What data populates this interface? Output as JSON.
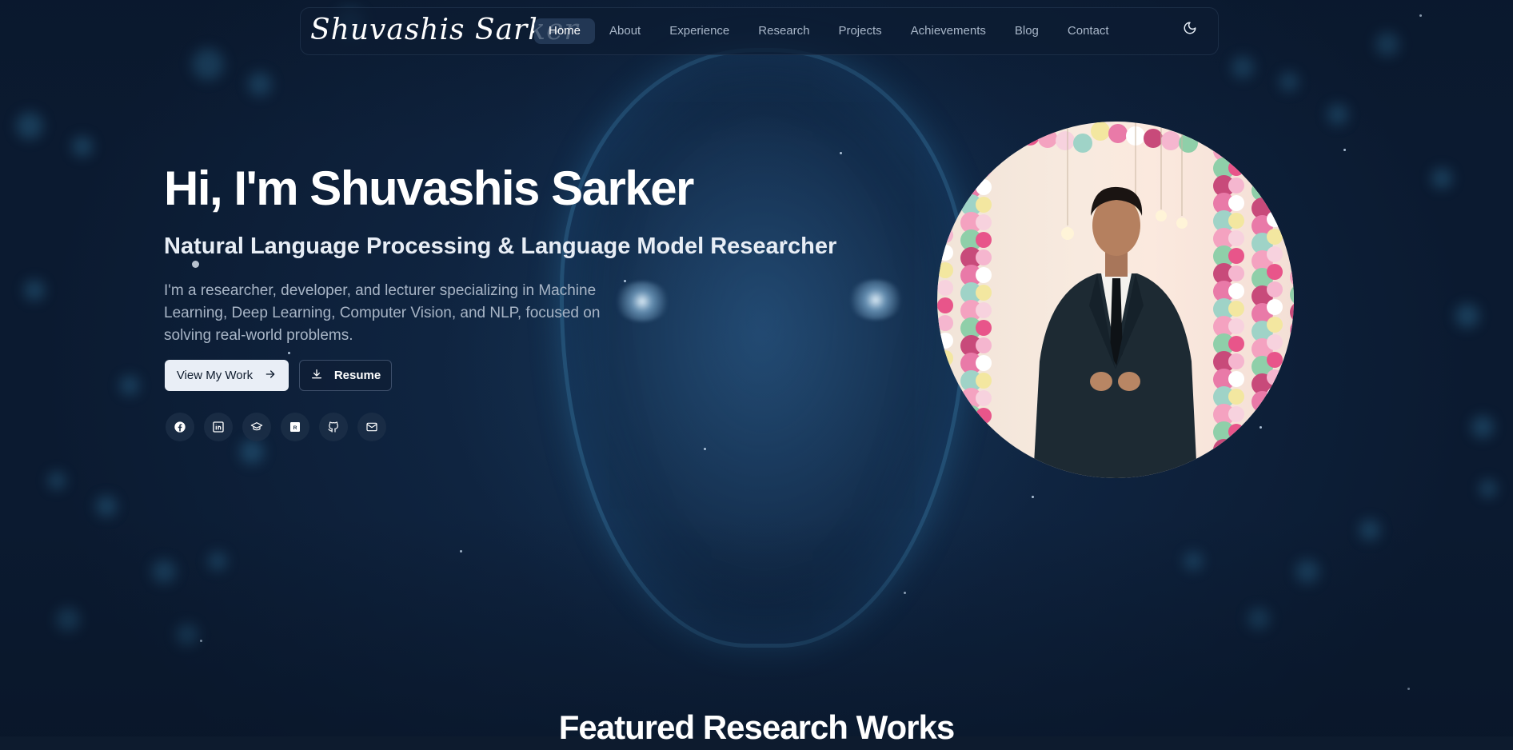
{
  "nav": {
    "logo": "Shuvashis Sarker",
    "links": [
      "Home",
      "About",
      "Experience",
      "Research",
      "Projects",
      "Achievements",
      "Blog",
      "Contact"
    ],
    "active": "Home",
    "theme_toggle_icon": "moon-icon"
  },
  "hero": {
    "title": "Hi, I'm Shuvashis Sarker",
    "subtitle": "Natural Language Processing & Language Model Researcher",
    "description": "I'm a researcher, developer, and lecturer specializing in Machine Learning, Deep Learning, Computer Vision, and NLP, focused on solving real-world problems.",
    "primary_button": "View My Work",
    "primary_button_icon": "arrow-right-icon",
    "secondary_button": "Resume",
    "secondary_button_icon": "download-icon",
    "socials": [
      "facebook-icon",
      "linkedin-icon",
      "graduation-cap-icon",
      "researchgate-icon",
      "github-icon",
      "mail-icon"
    ]
  },
  "portrait": {
    "icon": "profile-photo"
  },
  "featured": {
    "title": "Featured Research Works"
  },
  "colors": {
    "background": "#0d1b2e",
    "accent": "#e9eef6",
    "nav_bg": "#0c1c32"
  }
}
